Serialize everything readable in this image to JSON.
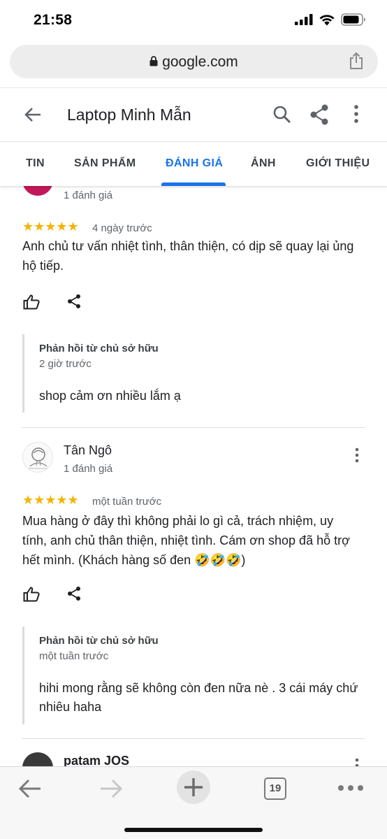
{
  "status_bar": {
    "time": "21:58"
  },
  "browser": {
    "url": "google.com",
    "open_tabs": "19"
  },
  "header": {
    "title": "Laptop Minh Mẫn"
  },
  "tabs": [
    {
      "label": "TIN"
    },
    {
      "label": "SẢN PHẨM"
    },
    {
      "label": "ĐÁNH GIÁ"
    },
    {
      "label": "ẢNH"
    },
    {
      "label": "GIỚI THIỆU"
    }
  ],
  "active_tab": "ĐÁNH GIÁ",
  "reviews": [
    {
      "review_count": "1 đánh giá",
      "rating": 5,
      "stars": "★★★★★",
      "time": "4 ngày trước",
      "text": "Anh chủ tư vấn nhiệt tình, thân thiện, có dịp sẽ quay lại ủng hộ tiếp.",
      "owner_reply": {
        "title": "Phản hồi từ chủ sở hữu",
        "time": "2 giờ trước",
        "text": "shop cảm ơn nhiều lắm ạ"
      }
    },
    {
      "name": "Tân Ngô",
      "review_count": "1 đánh giá",
      "rating": 5,
      "stars": "★★★★★",
      "time": "một tuần trước",
      "text": "Mua hàng ở đây thì không phải lo gì cả, trách nhiệm, uy tính, anh chủ thân thiện, nhiệt tình. Cám ơn shop đã hỗ trợ hết mình. (Khách hàng số đen 🤣🤣🤣)",
      "owner_reply": {
        "title": "Phản hồi từ chủ sở hữu",
        "time": "một tuần trước",
        "text": "hihi mong rằng sẽ không còn đen nữa nè . 3 cái máy chứ nhiêu haha"
      }
    },
    {
      "name": "patam JOS"
    }
  ],
  "colors": {
    "accent": "#1a73e8",
    "star": "#f3b400",
    "text": "#202124",
    "muted": "#5f6368"
  }
}
